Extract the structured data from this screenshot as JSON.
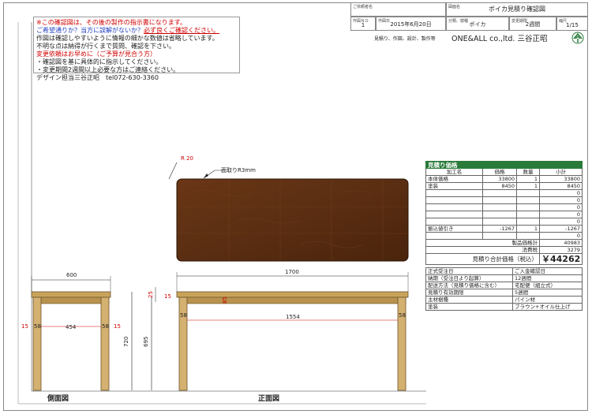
{
  "notes": {
    "line1": "※この確認図は、その後の製作の指示書になります。",
    "line2a": "ご希望通りか？当方に誤解がないか？",
    "line2b": "必ず良くご確認ください。",
    "line3": "作図は確認しやすいように情報の細かな数値は省略しています。",
    "line4": "不明な点は納得が行くまで質問、確認を下さい。",
    "line5": "変更依頼はお早めに（ご予算が見合う方）",
    "line6": "・確認図を基に具体的に指示してください。",
    "line7": "・変更期間2週間以上必要な方はご連絡ください。",
    "line8": "デザイン担当三谷正昭　tel072-630-3360"
  },
  "title_block": {
    "customer_label": "ご依頼者名",
    "drawing_name_label": "図面名",
    "drawing_name": "ボイカ見積り確認図",
    "drawing_no_label": "作図ＮＯ",
    "drawing_no": "1",
    "date_label": "作図日",
    "date": "2015年6月20日",
    "category_label": "分類、樹種",
    "category": "ボイカ",
    "change_label": "変更期限",
    "change_period": "2週間",
    "scale_label": "縮尺",
    "scale": "1/15",
    "services": "見積り、作図、設計、製作等",
    "company": "ONE&ALL co.,ltd. 三谷正昭"
  },
  "drawing": {
    "radius_label": "R 20",
    "chamfer_label": "面取りR3mm",
    "side_view_label": "側面図",
    "front_view_label": "正面図",
    "dims": {
      "side_width": "600",
      "side_inner": "454",
      "side_leg_left": "15",
      "side_leg_left2": "58",
      "side_leg_right": "58",
      "side_leg_right2": "15",
      "height_total": "720",
      "height_under": "695",
      "top_thickness": "25",
      "front_width": "1700",
      "front_inner": "1554",
      "front_overhang": "15",
      "front_leg_left": "58",
      "front_leg_right": "58",
      "apron": "85"
    }
  },
  "estimate": {
    "title": "見積り価格",
    "col_item": "加工名",
    "col_price": "価格",
    "col_qty": "数量",
    "col_subtotal": "小計",
    "rows": [
      {
        "item": "本体価格",
        "price": "33800",
        "qty": "1",
        "subtotal": "33800"
      },
      {
        "item": "塗装",
        "price": "8450",
        "qty": "1",
        "subtotal": "8450"
      },
      {
        "item": "",
        "price": "",
        "qty": "",
        "subtotal": "0"
      },
      {
        "item": "",
        "price": "",
        "qty": "",
        "subtotal": "0"
      },
      {
        "item": "",
        "price": "",
        "qty": "",
        "subtotal": "0"
      },
      {
        "item": "",
        "price": "",
        "qty": "",
        "subtotal": "0"
      },
      {
        "item": "",
        "price": "",
        "qty": "",
        "subtotal": "0"
      },
      {
        "item": "振込値引き",
        "price": "-1267",
        "qty": "1",
        "subtotal": "-1267"
      },
      {
        "item": "",
        "price": "",
        "qty": "",
        "subtotal": "0"
      }
    ],
    "product_total_label": "製品価格計",
    "product_total": "40983",
    "tax_label": "消費税",
    "tax": "3279",
    "grand_label": "見積り合計価格（税込）",
    "grand_total": "￥44262",
    "info": [
      {
        "label": "正式受注日",
        "value": "ご入金確認日"
      },
      {
        "label": "納期（受注日より起算）",
        "value": "12週間"
      },
      {
        "label": "配送方法（見積り価格に含む）",
        "value": "宅配便（組立式）"
      },
      {
        "label": "見積り有効期限",
        "value": "5週間"
      },
      {
        "label": "主材樹種",
        "value": "パイン材"
      },
      {
        "label": "塗装",
        "value": "ブラウン+オイル仕上げ"
      }
    ]
  },
  "colors": {
    "wood_dark": "#5a2e12",
    "wood_light": "#c9a35c",
    "header_green": "#2a7a3a",
    "note_red": "#d00000",
    "note_blue": "#2040c0"
  }
}
